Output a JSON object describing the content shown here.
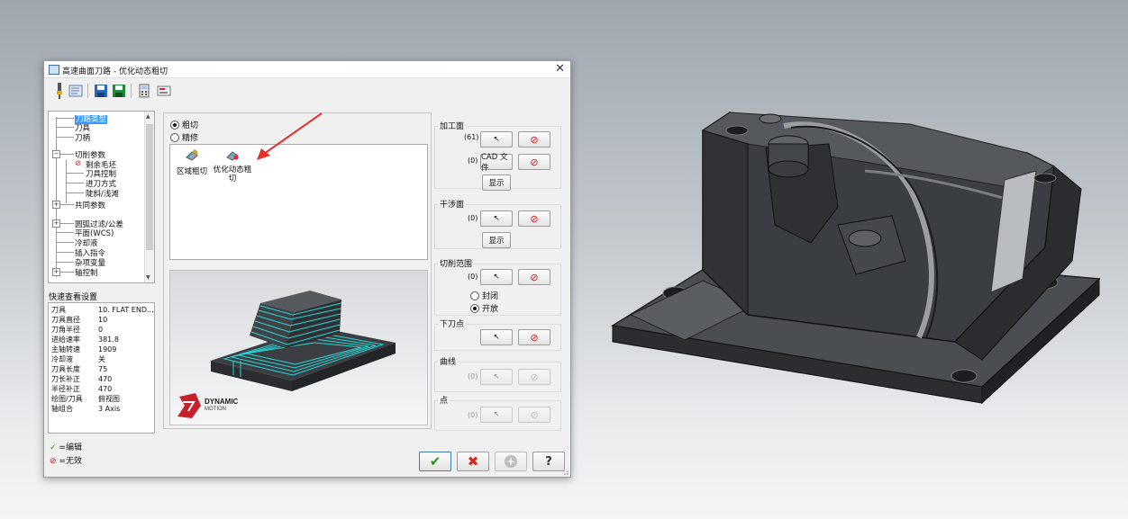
{
  "window": {
    "title": "高速曲面刀路 - 优化动态粗切"
  },
  "tree": {
    "items": [
      {
        "label": "刀路类型",
        "selected": true
      },
      {
        "label": "刀具"
      },
      {
        "label": "刀柄"
      },
      {
        "label": "切削参数"
      },
      {
        "label": "剩余毛坯"
      },
      {
        "label": "刀具控制"
      },
      {
        "label": "进刀方式"
      },
      {
        "label": "陡斜/浅滩"
      },
      {
        "label": "共同参数"
      },
      {
        "label": "圆弧过滤/公差"
      },
      {
        "label": "平面(WCS)"
      },
      {
        "label": "冷却液"
      },
      {
        "label": "插入指令"
      },
      {
        "label": "杂项变量"
      },
      {
        "label": "轴控制"
      }
    ]
  },
  "quick_view": {
    "title": "快速查看设置",
    "rows": [
      {
        "key": "刀具",
        "value": "10. FLAT END..."
      },
      {
        "key": "刀具直径",
        "value": "10"
      },
      {
        "key": "刀角半径",
        "value": "0"
      },
      {
        "key": "进给速率",
        "value": "381.8"
      },
      {
        "key": "主轴转速",
        "value": "1909"
      },
      {
        "key": "冷却液",
        "value": "关"
      },
      {
        "key": "刀具长度",
        "value": "75"
      },
      {
        "key": "刀长补正",
        "value": "470"
      },
      {
        "key": "半径补正",
        "value": "470"
      },
      {
        "key": "绘图/刀具",
        "value": "俯视图"
      },
      {
        "key": "轴组合",
        "value": "3 Axis"
      }
    ]
  },
  "legend": {
    "edit": "=编辑",
    "invalid": "=无效"
  },
  "mode": {
    "rough": "粗切",
    "finish": "精修",
    "selected": "rough"
  },
  "methods": [
    {
      "label": "区域粗切"
    },
    {
      "label": "优化动态粗切",
      "selected": true
    }
  ],
  "preview": {
    "logo_line1": "DYNAMIC",
    "logo_line2": "MOTION"
  },
  "groups": {
    "machining_surface": {
      "label": "加工面",
      "count1": "(61)",
      "count2": "(0)",
      "cad_file": "CAD 文件",
      "show": "显示"
    },
    "check_surface": {
      "label": "干涉面",
      "count": "(0)",
      "show": "显示"
    },
    "cut_range": {
      "label": "切削范围",
      "count": "(0)",
      "closed": "封闭",
      "open": "开放",
      "selected": "open"
    },
    "entry_point": {
      "label": "下刀点"
    },
    "curve": {
      "label": "曲线",
      "count": "(0)"
    },
    "point": {
      "label": "点",
      "count": "(0)"
    }
  },
  "colors": {
    "accent": "#3399ff",
    "arrow": "#e8302a",
    "toolpath": "#27d7d7",
    "ok": "#1f9a1f",
    "cancel": "#d62a1e"
  }
}
